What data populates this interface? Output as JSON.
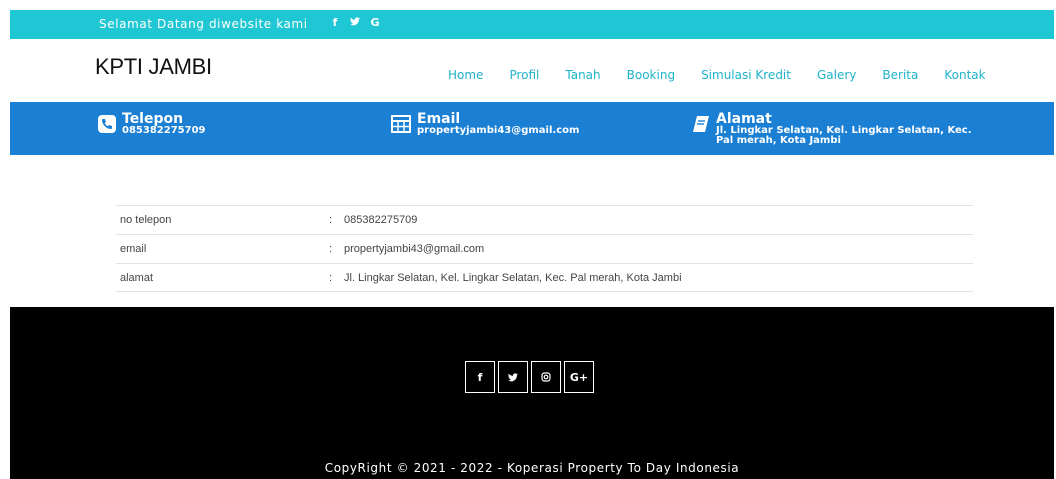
{
  "topbar": {
    "welcome": "Selamat Datang diwebsite kami",
    "social": [
      "f",
      "❤",
      "G"
    ]
  },
  "header": {
    "brand": "KPTI JAMBI",
    "nav": [
      "Home",
      "Profil",
      "Tanah",
      "Booking",
      "Simulasi Kredit",
      "Galery",
      "Berita",
      "Kontak"
    ]
  },
  "infobar": {
    "phone": {
      "title": "Telepon",
      "value": "085382275709"
    },
    "email": {
      "title": "Email",
      "value": "propertyjambi43@gmail.com"
    },
    "address": {
      "title": "Alamat",
      "line1": "Jl. Lingkar Selatan, Kel. Lingkar Selatan, Kec.",
      "line2": "Pal merah, Kota Jambi"
    }
  },
  "details": [
    {
      "label": "no telepon",
      "sep": ":",
      "value": "085382275709"
    },
    {
      "label": "email",
      "sep": ":",
      "value": "propertyjambi43@gmail.com"
    },
    {
      "label": "alamat",
      "sep": ":",
      "value": "Jl. Lingkar Selatan, Kel. Lingkar Selatan, Kec. Pal merah, Kota Jambi"
    }
  ],
  "footer": {
    "social": [
      "f",
      "❤",
      "◎",
      "G+"
    ],
    "copyright": "CopyRight © 2021 - 2022 - Koperasi Property To Day Indonesia"
  },
  "colors": {
    "topbar": "#1fc6d4",
    "nav": "#1fb3c9",
    "infobar": "#1b7fd3",
    "footer": "#000000"
  }
}
